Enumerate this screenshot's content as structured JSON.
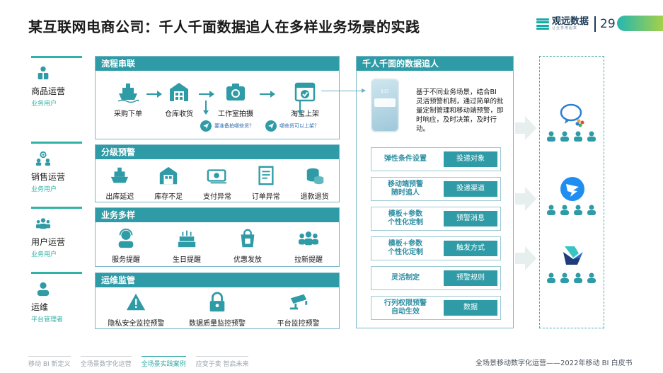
{
  "header": {
    "title": "某互联网电商公司：千人千面数据追人在多样业务场景的实践",
    "logo_text": "观远数据",
    "logo_sub": "让业务用起来",
    "page_number": "29"
  },
  "roles": [
    {
      "name": "商品运营",
      "sub": "业务用户",
      "icon": "people-icon"
    },
    {
      "name": "销售运营",
      "sub": "业务用户",
      "icon": "location-people-icon"
    },
    {
      "name": "用户运营",
      "sub": "业务用户",
      "icon": "group-icon"
    },
    {
      "name": "运维",
      "sub": "平台管理者",
      "icon": "person-icon"
    }
  ],
  "flow": {
    "title": "流程串联",
    "steps": [
      "采购下单",
      "仓库收货",
      "工作室拍摄",
      "淘宝上架"
    ],
    "questions": [
      "要准备拍哪些货？",
      "哪些货可以上架？"
    ]
  },
  "alert": {
    "title": "分级预警",
    "items": [
      "出库延迟",
      "库存不足",
      "支付异常",
      "订单异常",
      "退款退货"
    ]
  },
  "business": {
    "title": "业务多样",
    "items": [
      "服务提醒",
      "生日提醒",
      "优惠发放",
      "拉新提醒"
    ]
  },
  "ops": {
    "title": "运维监管",
    "items": [
      "隐私安全监控预警",
      "数据质量监控预警",
      "平台监控预警"
    ]
  },
  "right": {
    "title": "千人千面的数据追人",
    "phone_time": "3:37",
    "description": "基于不同业务场景，结合BI 灵活预警机制，通过简单的批量定制管理和移动端预警，即时响应，及时决策，及时行动。",
    "rows": [
      {
        "left": "弹性条件设置",
        "right": "投递对象"
      },
      {
        "left": "移动端预警\n随时追人",
        "right": "投递渠道"
      },
      {
        "left": "模板+参数\n个性化定制",
        "right": "预警消息"
      },
      {
        "left": "模板+参数\n个性化定制",
        "right": "触发方式"
      },
      {
        "left": "灵活制定",
        "right": "预警规则"
      },
      {
        "left": "行列权限预警\n自动生效",
        "right": "数据"
      }
    ]
  },
  "channels": [
    "wecom-icon",
    "dingtalk-icon",
    "feishu-icon"
  ],
  "colors": {
    "teal": "#2f9ba6",
    "accent": "#30b3a6"
  },
  "footer": {
    "tabs": [
      "移动 BI 新定义",
      "全场景数字化运营",
      "全场景实践案例",
      "应变于卖  智启未来"
    ],
    "active_index": 2,
    "right_text": "全场景移动数字化运营——2022年移动 BI 白皮书"
  }
}
